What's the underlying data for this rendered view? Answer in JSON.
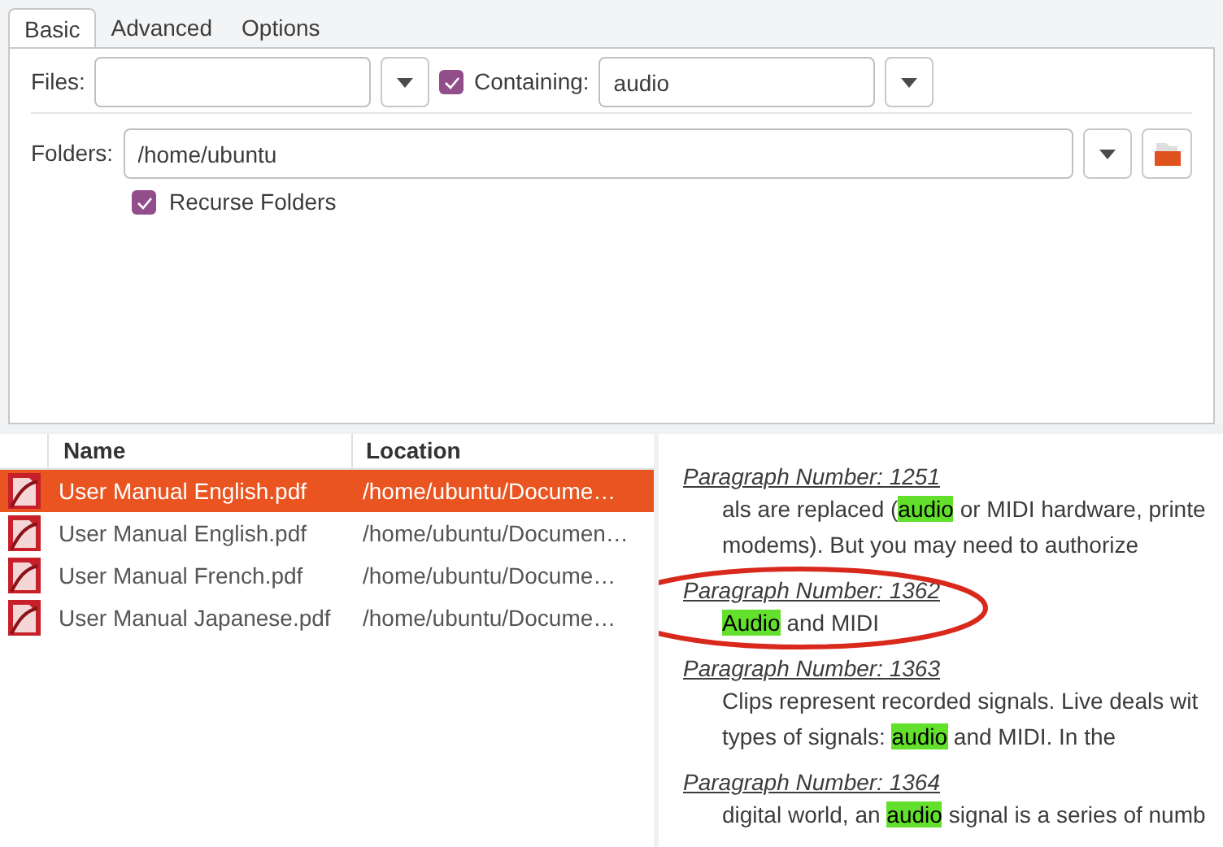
{
  "tabs": [
    {
      "label": "Basic",
      "selected": true
    },
    {
      "label": "Advanced",
      "selected": false
    },
    {
      "label": "Options",
      "selected": false
    }
  ],
  "files": {
    "label": "Files:"
  },
  "containing": {
    "label": "Containing:",
    "checked": true,
    "value": "audio"
  },
  "folders": {
    "label": "Folders:",
    "value": "/home/ubuntu"
  },
  "recurse": {
    "label": "Recurse Folders",
    "checked": true
  },
  "table": {
    "columns": [
      "Name",
      "Location"
    ],
    "rows": [
      {
        "name": "User Manual English.pdf",
        "location": "/home/ubuntu/Docume…",
        "selected": true
      },
      {
        "name": "User Manual English.pdf",
        "location": "/home/ubuntu/Documen…",
        "selected": false
      },
      {
        "name": "User Manual French.pdf",
        "location": "/home/ubuntu/Docume…",
        "selected": false
      },
      {
        "name": "User Manual Japanese.pdf",
        "location": "/home/ubuntu/Docume…",
        "selected": false
      }
    ]
  },
  "results": [
    {
      "heading": "Paragraph Number: 1251",
      "lines": [
        [
          {
            "text": "als are replaced (",
            "highlight": false
          },
          {
            "text": "audio",
            "highlight": true
          },
          {
            "text": " or MIDI hardware, printe",
            "highlight": false
          }
        ],
        [
          {
            "text": "modems). But you may need to authorize",
            "highlight": false
          }
        ]
      ],
      "circled": false
    },
    {
      "heading": "Paragraph Number: 1362",
      "lines": [
        [
          {
            "text": "Audio",
            "highlight": true
          },
          {
            "text": " and MIDI",
            "highlight": false
          }
        ]
      ],
      "circled": true
    },
    {
      "heading": "Paragraph Number: 1363",
      "lines": [
        [
          {
            "text": "Clips represent recorded signals. Live deals wit",
            "highlight": false
          }
        ],
        [
          {
            "text": "types of signals: ",
            "highlight": false
          },
          {
            "text": "audio",
            "highlight": true
          },
          {
            "text": " and MIDI. In the",
            "highlight": false
          }
        ]
      ],
      "circled": false
    },
    {
      "heading": "Paragraph Number: 1364",
      "lines": [
        [
          {
            "text": "digital world, an ",
            "highlight": false
          },
          {
            "text": "audio",
            "highlight": true
          },
          {
            "text": " signal is a series of numb",
            "highlight": false
          }
        ]
      ],
      "circled": false
    }
  ]
}
